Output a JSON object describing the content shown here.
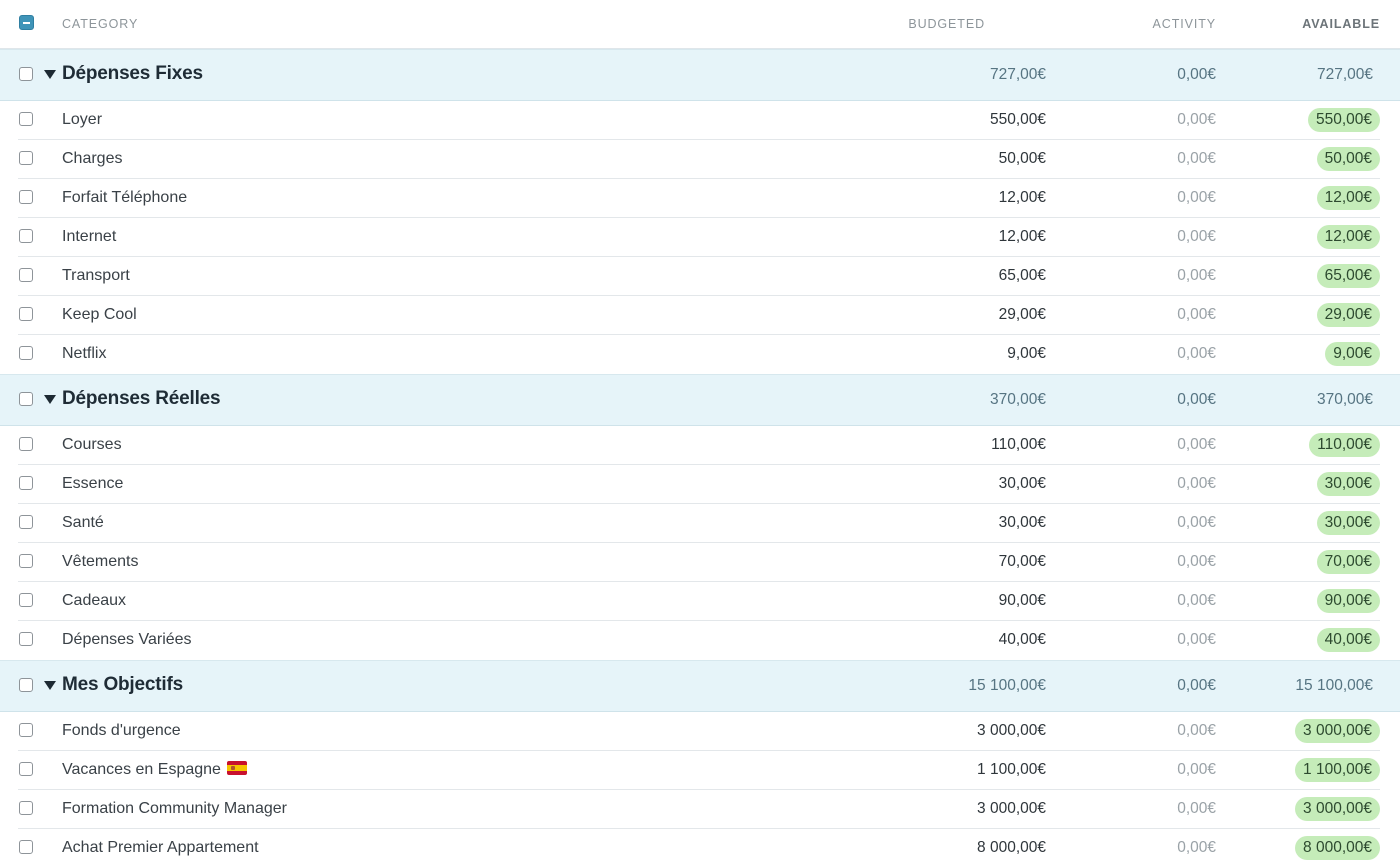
{
  "header": {
    "category_label": "CATEGORY",
    "budgeted_label": "BUDGETED",
    "activity_label": "ACTIVITY",
    "available_label": "AVAILABLE"
  },
  "colors": {
    "group_background": "#e6f4f9",
    "available_pill": "#c5ecb9",
    "master_checkbox": "#3f94b8"
  },
  "groups": [
    {
      "name": "Dépenses Fixes",
      "budgeted": "727,00€",
      "activity": "0,00€",
      "available": "727,00€",
      "items": [
        {
          "name": "Loyer",
          "budgeted": "550,00€",
          "activity": "0,00€",
          "available": "550,00€"
        },
        {
          "name": "Charges",
          "budgeted": "50,00€",
          "activity": "0,00€",
          "available": "50,00€"
        },
        {
          "name": "Forfait Téléphone",
          "budgeted": "12,00€",
          "activity": "0,00€",
          "available": "12,00€"
        },
        {
          "name": "Internet",
          "budgeted": "12,00€",
          "activity": "0,00€",
          "available": "12,00€"
        },
        {
          "name": "Transport",
          "budgeted": "65,00€",
          "activity": "0,00€",
          "available": "65,00€"
        },
        {
          "name": "Keep Cool",
          "budgeted": "29,00€",
          "activity": "0,00€",
          "available": "29,00€"
        },
        {
          "name": "Netflix",
          "budgeted": "9,00€",
          "activity": "0,00€",
          "available": "9,00€"
        }
      ]
    },
    {
      "name": "Dépenses Réelles",
      "budgeted": "370,00€",
      "activity": "0,00€",
      "available": "370,00€",
      "items": [
        {
          "name": "Courses",
          "budgeted": "110,00€",
          "activity": "0,00€",
          "available": "110,00€"
        },
        {
          "name": "Essence",
          "budgeted": "30,00€",
          "activity": "0,00€",
          "available": "30,00€"
        },
        {
          "name": "Santé",
          "budgeted": "30,00€",
          "activity": "0,00€",
          "available": "30,00€"
        },
        {
          "name": "Vêtements",
          "budgeted": "70,00€",
          "activity": "0,00€",
          "available": "70,00€"
        },
        {
          "name": "Cadeaux",
          "budgeted": "90,00€",
          "activity": "0,00€",
          "available": "90,00€"
        },
        {
          "name": "Dépenses Variées",
          "budgeted": "40,00€",
          "activity": "0,00€",
          "available": "40,00€"
        }
      ]
    },
    {
      "name": "Mes Objectifs",
      "budgeted": "15 100,00€",
      "activity": "0,00€",
      "available": "15 100,00€",
      "items": [
        {
          "name": "Fonds d'urgence",
          "budgeted": "3 000,00€",
          "activity": "0,00€",
          "available": "3 000,00€"
        },
        {
          "name": "Vacances en Espagne",
          "icon": "spain-flag-icon",
          "budgeted": "1 100,00€",
          "activity": "0,00€",
          "available": "1 100,00€"
        },
        {
          "name": "Formation Community Manager",
          "budgeted": "3 000,00€",
          "activity": "0,00€",
          "available": "3 000,00€"
        },
        {
          "name": "Achat Premier Appartement",
          "budgeted": "8 000,00€",
          "activity": "0,00€",
          "available": "8 000,00€"
        }
      ]
    }
  ]
}
